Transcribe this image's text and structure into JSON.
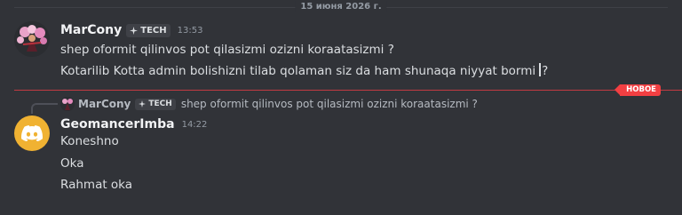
{
  "date_divider": "15 июня 2026 г.",
  "message_1": {
    "username": "MarCony",
    "tag": "TECH",
    "timestamp": "13:53",
    "lines": [
      "shep oformit qilinvos pot qilasizmi ozizni koraatasizmi ?",
      "Kotarilib Kotta admin bolishizni tilab qolaman siz da ham shunaqa niyyat bormi",
      "?"
    ]
  },
  "new_divider": "НОВОЕ",
  "reply_preview": {
    "username": "MarCony",
    "tag": "TECH",
    "text": "shep oformit qilinvos pot qilasizmi ozizni koraatasizmi ?"
  },
  "message_2": {
    "username": "GeomancerImba",
    "timestamp": "14:22",
    "lines": [
      "Koneshno",
      "Oka",
      "Rahmat oka"
    ]
  },
  "colors": {
    "background": "#313338",
    "new_accent": "#f23f42",
    "avatar_2_bg": "#f0b232"
  },
  "icons": {
    "tag_icon": "sparkle-icon",
    "avatar_2": "discord-logo-icon"
  }
}
